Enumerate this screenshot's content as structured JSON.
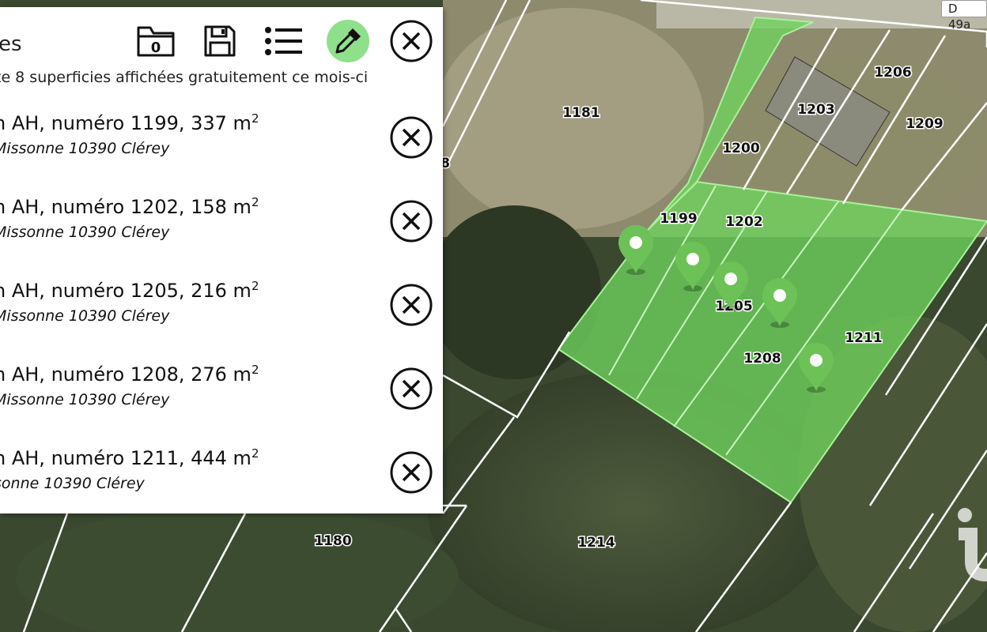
{
  "map": {
    "road_label": "D 49a",
    "plots": [
      {
        "id": "p1181",
        "label": "1181"
      },
      {
        "id": "p1199",
        "label": "1199"
      },
      {
        "id": "p1200",
        "label": "1200"
      },
      {
        "id": "p1202",
        "label": "1202"
      },
      {
        "id": "p1203",
        "label": "1203"
      },
      {
        "id": "p1205",
        "label": "1205"
      },
      {
        "id": "p1206",
        "label": "1206"
      },
      {
        "id": "p1208",
        "label": "1208"
      },
      {
        "id": "p1209",
        "label": "1209"
      },
      {
        "id": "p1211",
        "label": "1211"
      },
      {
        "id": "p1214",
        "label": "1214"
      },
      {
        "id": "p1180",
        "label": "1180"
      },
      {
        "id": "pedge",
        "label": "8"
      }
    ],
    "colors": {
      "selected_fill": "#6fd45e",
      "selected_stroke": "#a8f29a",
      "marker": "#6cc257",
      "plot_line": "#ffffff"
    }
  },
  "panel": {
    "title": "es",
    "free_note": "te 8 superficies affichées gratuitement ce mois-ci",
    "toolbar": {
      "folder_count": "0",
      "folder_icon": "folder-icon",
      "save_icon": "save-icon",
      "list_icon": "list-icon",
      "picker_icon": "eyedropper-icon",
      "close_icon": "close-icon"
    },
    "parcels": [
      {
        "title": "n AH, numéro 1199, 337 m",
        "unit_sup": "2",
        "address": "Missonne 10390 Clérey"
      },
      {
        "title": "n AH, numéro 1202, 158 m",
        "unit_sup": "2",
        "address": "Missonne 10390 Clérey"
      },
      {
        "title": "n AH, numéro 1205, 216 m",
        "unit_sup": "2",
        "address": "Missonne 10390 Clérey"
      },
      {
        "title": "n AH, numéro 1208, 276 m",
        "unit_sup": "2",
        "address": "Missonne 10390 Clérey"
      },
      {
        "title": "n AH, numéro 1211, 444 m",
        "unit_sup": "2",
        "address": "sonne 10390 Clérey"
      }
    ]
  }
}
